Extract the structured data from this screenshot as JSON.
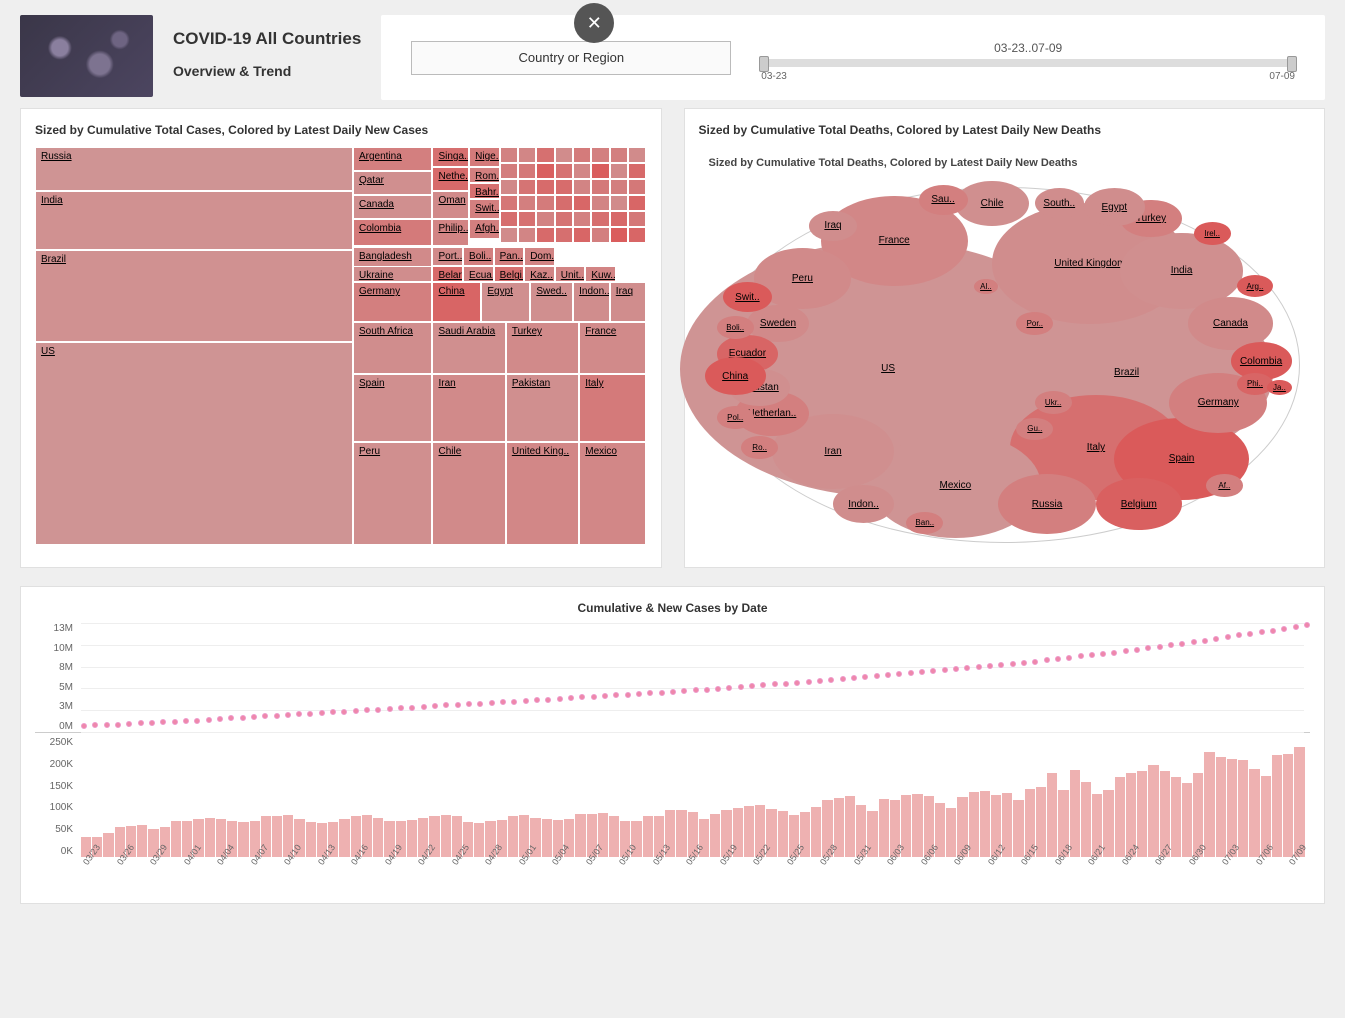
{
  "header": {
    "title": "COVID-19 All Countries",
    "subtitle": "Overview & Trend",
    "filter_label": "Country or Region",
    "slider_range": "03-23..07-09",
    "slider_start": "03-23",
    "slider_end": "07-09"
  },
  "panel_cases": {
    "title": "Sized by Cumulative Total Cases, Colored by Latest Daily New Cases"
  },
  "panel_deaths": {
    "title": "Sized by Cumulative Total Deaths, Colored by Latest Daily New Deaths",
    "subtitle": "Sized by Cumulative Total Deaths, Colored by Latest Daily New Deaths"
  },
  "panel_combo": {
    "title": "Cumulative & New Cases by Date"
  },
  "chart_data": [
    {
      "type": "treemap",
      "title": "Sized by Cumulative Total Cases, Colored by Latest Daily New Cases",
      "note": "size = cumulative total cases (relative), color_value = latest daily new cases (relative intensity 0-1)",
      "items": [
        {
          "name": "Russia",
          "size": 20,
          "color_value": 0.35
        },
        {
          "name": "India",
          "size": 24,
          "color_value": 0.38
        },
        {
          "name": "Brazil",
          "size": 42,
          "color_value": 0.38
        },
        {
          "name": "US",
          "size": 72,
          "color_value": 0.35
        },
        {
          "name": "Argentina",
          "size": 6,
          "color_value": 0.55
        },
        {
          "name": "Qatar",
          "size": 6,
          "color_value": 0.4
        },
        {
          "name": "Canada",
          "size": 6,
          "color_value": 0.4
        },
        {
          "name": "Colombia",
          "size": 6,
          "color_value": 0.6
        },
        {
          "name": "Bangladesh",
          "size": 7,
          "color_value": 0.45
        },
        {
          "name": "Germany",
          "size": 7,
          "color_value": 0.55
        },
        {
          "name": "South Africa",
          "size": 9,
          "color_value": 0.42
        },
        {
          "name": "Spain",
          "size": 9,
          "color_value": 0.4
        },
        {
          "name": "Peru",
          "size": 9,
          "color_value": 0.4
        },
        {
          "name": "Singa..",
          "size": 2,
          "color_value": 0.7
        },
        {
          "name": "Nethe..",
          "size": 2,
          "color_value": 0.75
        },
        {
          "name": "Oman",
          "size": 2,
          "color_value": 0.45
        },
        {
          "name": "Philip..",
          "size": 2,
          "color_value": 0.5
        },
        {
          "name": "China",
          "size": 4,
          "color_value": 0.8
        },
        {
          "name": "Saudi Arabia",
          "size": 9,
          "color_value": 0.4
        },
        {
          "name": "Iran",
          "size": 9,
          "color_value": 0.45
        },
        {
          "name": "Chile",
          "size": 9,
          "color_value": 0.45
        },
        {
          "name": "Nige..",
          "size": 1.5,
          "color_value": 0.6
        },
        {
          "name": "Rom..",
          "size": 1.5,
          "color_value": 0.55
        },
        {
          "name": "Bahr..",
          "size": 1.5,
          "color_value": 0.7
        },
        {
          "name": "Swit..",
          "size": 1.5,
          "color_value": 0.55
        },
        {
          "name": "Afgh..",
          "size": 1.5,
          "color_value": 0.55
        },
        {
          "name": "Port..",
          "size": 1.5,
          "color_value": 0.45
        },
        {
          "name": "Belar..",
          "size": 1.5,
          "color_value": 0.75
        },
        {
          "name": "Ecua..",
          "size": 1.5,
          "color_value": 0.5
        },
        {
          "name": "Egypt",
          "size": 3,
          "color_value": 0.4
        },
        {
          "name": "Turkey",
          "size": 8,
          "color_value": 0.45
        },
        {
          "name": "Pakistan",
          "size": 8,
          "color_value": 0.4
        },
        {
          "name": "United King..",
          "size": 8,
          "color_value": 0.48
        },
        {
          "name": "Boli..",
          "size": 1,
          "color_value": 0.55
        },
        {
          "name": "Pan..",
          "size": 1,
          "color_value": 0.55
        },
        {
          "name": "Belgi..",
          "size": 1,
          "color_value": 0.7
        },
        {
          "name": "Kaz..",
          "size": 1,
          "color_value": 0.5
        },
        {
          "name": "Swed..",
          "size": 2,
          "color_value": 0.4
        },
        {
          "name": "Indon..",
          "size": 2,
          "color_value": 0.42
        },
        {
          "name": "France",
          "size": 7,
          "color_value": 0.45
        },
        {
          "name": "Italy",
          "size": 7,
          "color_value": 0.6
        },
        {
          "name": "Mexico",
          "size": 7,
          "color_value": 0.48
        },
        {
          "name": "Dom..",
          "size": 1,
          "color_value": 0.5
        },
        {
          "name": "Unit..",
          "size": 1,
          "color_value": 0.5
        },
        {
          "name": "Kuw..",
          "size": 1,
          "color_value": 0.5
        },
        {
          "name": "Iraq",
          "size": 2,
          "color_value": 0.42
        },
        {
          "name": "Ukraine",
          "size": 2,
          "color_value": 0.42
        }
      ]
    },
    {
      "type": "bubble",
      "title": "Sized by Cumulative Total Deaths, Colored by Latest Daily New Deaths",
      "note": "size = cumulative total deaths (relative), color_value = latest daily new deaths (relative intensity 0-1)",
      "items": [
        {
          "name": "US",
          "size": 100,
          "color_value": 0.35
        },
        {
          "name": "Brazil",
          "size": 55,
          "color_value": 0.35
        },
        {
          "name": "United Kingdom",
          "size": 40,
          "color_value": 0.42
        },
        {
          "name": "Italy",
          "size": 30,
          "color_value": 0.7
        },
        {
          "name": "Mexico",
          "size": 28,
          "color_value": 0.35
        },
        {
          "name": "France",
          "size": 25,
          "color_value": 0.48
        },
        {
          "name": "Spain",
          "size": 22,
          "color_value": 0.9
        },
        {
          "name": "India",
          "size": 20,
          "color_value": 0.4
        },
        {
          "name": "Iran",
          "size": 18,
          "color_value": 0.4
        },
        {
          "name": "Peru",
          "size": 14,
          "color_value": 0.45
        },
        {
          "name": "Russia",
          "size": 13,
          "color_value": 0.55
        },
        {
          "name": "Belgium",
          "size": 11,
          "color_value": 0.85
        },
        {
          "name": "Germany",
          "size": 11,
          "color_value": 0.55
        },
        {
          "name": "Canada",
          "size": 10,
          "color_value": 0.45
        },
        {
          "name": "Chile",
          "size": 9,
          "color_value": 0.4
        },
        {
          "name": "Netherlan..",
          "size": 8,
          "color_value": 0.55
        },
        {
          "name": "Sweden",
          "size": 7,
          "color_value": 0.45
        },
        {
          "name": "Turkey",
          "size": 7,
          "color_value": 0.55
        },
        {
          "name": "Ecuador",
          "size": 6,
          "color_value": 0.8
        },
        {
          "name": "Colombia",
          "size": 6,
          "color_value": 0.9
        },
        {
          "name": "Pakistan",
          "size": 6,
          "color_value": 0.4
        },
        {
          "name": "Egypt",
          "size": 6,
          "color_value": 0.42
        },
        {
          "name": "Indon..",
          "size": 5,
          "color_value": 0.42
        },
        {
          "name": "China",
          "size": 5,
          "color_value": 0.9
        },
        {
          "name": "Iraq",
          "size": 4,
          "color_value": 0.42
        },
        {
          "name": "South..",
          "size": 4,
          "color_value": 0.42
        },
        {
          "name": "Sau..",
          "size": 3,
          "color_value": 0.55
        },
        {
          "name": "Swit..",
          "size": 3,
          "color_value": 0.9
        },
        {
          "name": "Boli..",
          "size": 3,
          "color_value": 0.55
        },
        {
          "name": "Arg..",
          "size": 3,
          "color_value": 0.9
        },
        {
          "name": "Irel..",
          "size": 3,
          "color_value": 0.9
        },
        {
          "name": "Por..",
          "size": 3,
          "color_value": 0.55
        },
        {
          "name": "Pol..",
          "size": 3,
          "color_value": 0.55
        },
        {
          "name": "Ro..",
          "size": 3,
          "color_value": 0.55
        },
        {
          "name": "Phi..",
          "size": 3,
          "color_value": 0.8
        },
        {
          "name": "Ukr..",
          "size": 3,
          "color_value": 0.55
        },
        {
          "name": "Gu..",
          "size": 3,
          "color_value": 0.55
        },
        {
          "name": "Ban..",
          "size": 3,
          "color_value": 0.55
        },
        {
          "name": "Al..",
          "size": 2,
          "color_value": 0.55
        },
        {
          "name": "Af..",
          "size": 2,
          "color_value": 0.55
        },
        {
          "name": "Ja..",
          "size": 2,
          "color_value": 0.9
        }
      ]
    },
    {
      "type": "line",
      "title": "Cumulative Cases by Date",
      "xlabel": "",
      "ylabel": "",
      "ylim": [
        0,
        13000000
      ],
      "y_ticks": [
        "13M",
        "10M",
        "8M",
        "5M",
        "3M",
        "0M"
      ],
      "x": [
        "03/23",
        "03/24",
        "03/25",
        "03/26",
        "03/27",
        "03/28",
        "03/29",
        "03/30",
        "03/31",
        "04/01",
        "04/02",
        "04/03",
        "04/04",
        "04/05",
        "04/06",
        "04/07",
        "04/08",
        "04/09",
        "04/10",
        "04/11",
        "04/12",
        "04/13",
        "04/14",
        "04/15",
        "04/16",
        "04/17",
        "04/18",
        "04/19",
        "04/20",
        "04/21",
        "04/22",
        "04/23",
        "04/24",
        "04/25",
        "04/26",
        "04/27",
        "04/28",
        "04/29",
        "04/30",
        "05/01",
        "05/02",
        "05/03",
        "05/04",
        "05/05",
        "05/06",
        "05/07",
        "05/08",
        "05/09",
        "05/10",
        "05/11",
        "05/12",
        "05/13",
        "05/14",
        "05/15",
        "05/16",
        "05/17",
        "05/18",
        "05/19",
        "05/20",
        "05/21",
        "05/22",
        "05/23",
        "05/24",
        "05/25",
        "05/26",
        "05/27",
        "05/28",
        "05/29",
        "05/30",
        "05/31",
        "06/01",
        "06/02",
        "06/03",
        "06/04",
        "06/05",
        "06/06",
        "06/07",
        "06/08",
        "06/09",
        "06/10",
        "06/11",
        "06/12",
        "06/13",
        "06/14",
        "06/15",
        "06/16",
        "06/17",
        "06/18",
        "06/19",
        "06/20",
        "06/21",
        "06/22",
        "06/23",
        "06/24",
        "06/25",
        "06/26",
        "06/27",
        "06/28",
        "06/29",
        "06/30",
        "07/01",
        "07/02",
        "07/03",
        "07/04",
        "07/05",
        "07/06",
        "07/07",
        "07/08",
        "07/09"
      ],
      "values": [
        370000,
        420000,
        470000,
        530000,
        590000,
        660000,
        720000,
        780000,
        860000,
        930000,
        1010000,
        1100000,
        1200000,
        1270000,
        1350000,
        1430000,
        1520000,
        1600000,
        1700000,
        1780000,
        1850000,
        1920000,
        2000000,
        2080000,
        2160000,
        2250000,
        2320000,
        2400000,
        2480000,
        2560000,
        2630000,
        2720000,
        2810000,
        2900000,
        2970000,
        3040000,
        3120000,
        3200000,
        3260000,
        3350000,
        3430000,
        3510000,
        3590000,
        3670000,
        3760000,
        3850000,
        3940000,
        4020000,
        4100000,
        4180000,
        4260000,
        4350000,
        4440000,
        4540000,
        4630000,
        4710000,
        4800000,
        4900000,
        5000000,
        5100000,
        5210000,
        5310000,
        5410000,
        5500000,
        5590000,
        5700000,
        5820000,
        5940000,
        6060000,
        6170000,
        6270000,
        6390000,
        6510000,
        6630000,
        6770000,
        6900000,
        7010000,
        7120000,
        7240000,
        7360000,
        7500000,
        7630000,
        7770000,
        7900000,
        8040000,
        8180000,
        8350000,
        8490000,
        8660000,
        8820000,
        8950000,
        9100000,
        9270000,
        9440000,
        9630000,
        9820000,
        10000000,
        10180000,
        10350000,
        10530000,
        10740000,
        10950000,
        11160000,
        11360000,
        11550000,
        11720000,
        11950000,
        12170000,
        12400000
      ]
    },
    {
      "type": "bar",
      "title": "New Cases by Date",
      "xlabel": "",
      "ylabel": "",
      "ylim": [
        0,
        250000
      ],
      "y_ticks": [
        "250K",
        "200K",
        "150K",
        "100K",
        "50K",
        "0K"
      ],
      "categories": [
        "03/23",
        "03/24",
        "03/25",
        "03/26",
        "03/27",
        "03/28",
        "03/29",
        "03/30",
        "03/31",
        "04/01",
        "04/02",
        "04/03",
        "04/04",
        "04/05",
        "04/06",
        "04/07",
        "04/08",
        "04/09",
        "04/10",
        "04/11",
        "04/12",
        "04/13",
        "04/14",
        "04/15",
        "04/16",
        "04/17",
        "04/18",
        "04/19",
        "04/20",
        "04/21",
        "04/22",
        "04/23",
        "04/24",
        "04/25",
        "04/26",
        "04/27",
        "04/28",
        "04/29",
        "04/30",
        "05/01",
        "05/02",
        "05/03",
        "05/04",
        "05/05",
        "05/06",
        "05/07",
        "05/08",
        "05/09",
        "05/10",
        "05/11",
        "05/12",
        "05/13",
        "05/14",
        "05/15",
        "05/16",
        "05/17",
        "05/18",
        "05/19",
        "05/20",
        "05/21",
        "05/22",
        "05/23",
        "05/24",
        "05/25",
        "05/26",
        "05/27",
        "05/28",
        "05/29",
        "05/30",
        "05/31",
        "06/01",
        "06/02",
        "06/03",
        "06/04",
        "06/05",
        "06/06",
        "06/07",
        "06/08",
        "06/09",
        "06/10",
        "06/11",
        "06/12",
        "06/13",
        "06/14",
        "06/15",
        "06/16",
        "06/17",
        "06/18",
        "06/19",
        "06/20",
        "06/21",
        "06/22",
        "06/23",
        "06/24",
        "06/25",
        "06/26",
        "06/27",
        "06/28",
        "06/29",
        "06/30",
        "07/01",
        "07/02",
        "07/03",
        "07/04",
        "07/05",
        "07/06",
        "07/07",
        "07/08",
        "07/09"
      ],
      "values": [
        42000,
        41000,
        50000,
        62000,
        64000,
        67000,
        59000,
        63000,
        76000,
        76000,
        80000,
        82000,
        80000,
        74000,
        72000,
        75000,
        85000,
        86000,
        87000,
        79000,
        73000,
        70000,
        72000,
        80000,
        85000,
        87000,
        81000,
        75000,
        74000,
        77000,
        81000,
        85000,
        87000,
        85000,
        72000,
        70000,
        76000,
        78000,
        85000,
        88000,
        82000,
        79000,
        77000,
        79000,
        90000,
        89000,
        91000,
        86000,
        76000,
        75000,
        85000,
        86000,
        97000,
        97000,
        93000,
        79000,
        90000,
        97000,
        102000,
        107000,
        108000,
        100000,
        95000,
        88000,
        93000,
        105000,
        118000,
        122000,
        128000,
        108000,
        96000,
        121000,
        118000,
        130000,
        131000,
        127000,
        113000,
        103000,
        124000,
        136000,
        138000,
        129000,
        134000,
        119000,
        141000,
        145000,
        176000,
        139000,
        181000,
        157000,
        131000,
        139000,
        167000,
        176000,
        180000,
        192000,
        179000,
        166000,
        155000,
        175000,
        218000,
        208000,
        204000,
        203000,
        184000,
        168000,
        213000,
        214000,
        229000
      ]
    }
  ]
}
